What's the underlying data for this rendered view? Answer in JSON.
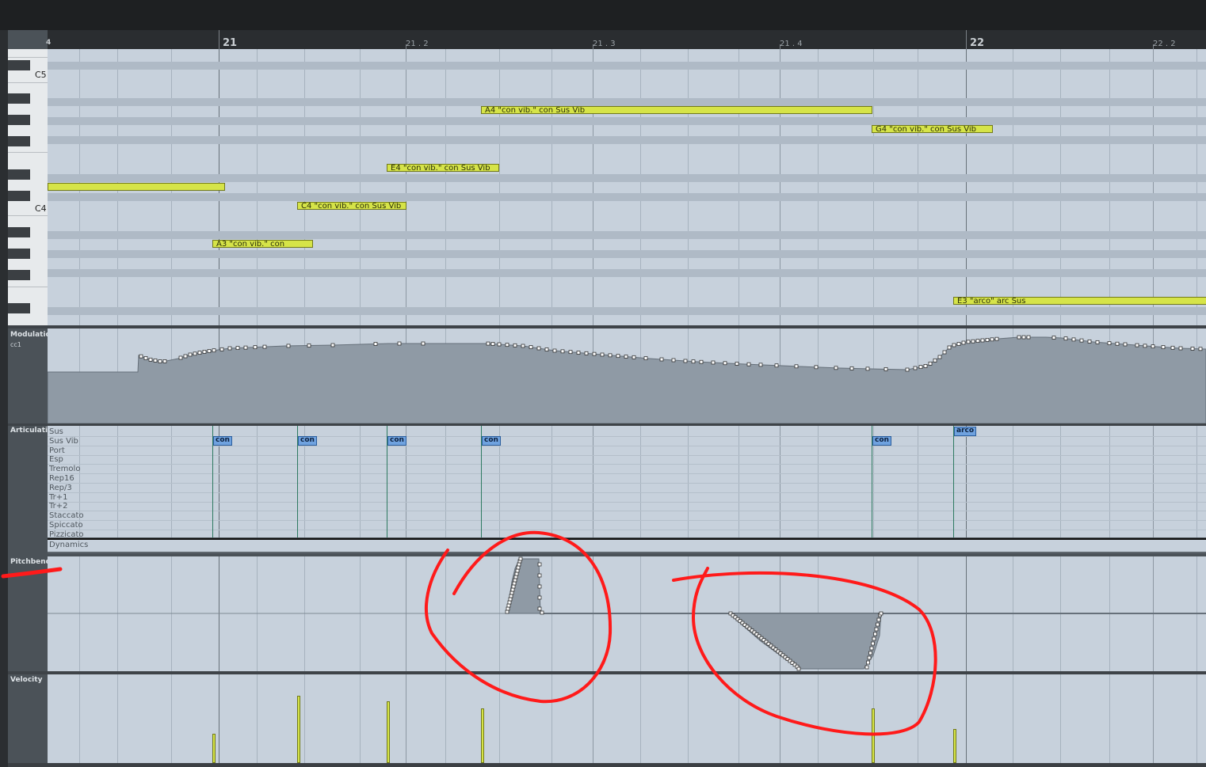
{
  "ruler": {
    "bars": [
      "21",
      "22"
    ],
    "beats": [
      "21 . 2",
      "21 . 3",
      "21 . 4",
      "22 . 2"
    ],
    "partial_left": "4"
  },
  "keyboard": {
    "c5_label": "C5",
    "c4_label": "C4"
  },
  "notes": [
    {
      "label": ""
    },
    {
      "label": "A3 \"con vib.\" con"
    },
    {
      "label": "C4 \"con vib.\" con Sus Vib"
    },
    {
      "label": "E4 \"con vib.\" con Sus Vib"
    },
    {
      "label": "A4 \"con vib.\" con Sus Vib"
    },
    {
      "label": "G4 \"con vib.\" con Sus Vib"
    },
    {
      "label": "E3 \"arco\" arc Sus"
    }
  ],
  "lanes": {
    "modulation": {
      "title": "Modulatio",
      "sub": "cc1"
    },
    "articulation": {
      "title": "Articulatio"
    },
    "pitchbend": {
      "title": "Pitchbend"
    },
    "velocity": {
      "title": "Velocity"
    },
    "dynamics": {
      "label": "Dynamics"
    }
  },
  "articulation_rows": [
    "Sus",
    "Sus Vib",
    "Port",
    "Esp",
    "Tremolo",
    "Rep16",
    "Rep/3",
    "Tr+1",
    "Tr+2",
    "Staccato",
    "Spiccato",
    "Pizzicato"
  ],
  "articulation_events": [
    {
      "tag": "con",
      "row": "Sus Vib"
    },
    {
      "tag": "con",
      "row": "Sus Vib"
    },
    {
      "tag": "con",
      "row": "Sus Vib"
    },
    {
      "tag": "con",
      "row": "Sus Vib"
    },
    {
      "tag": "con",
      "row": "Sus Vib"
    },
    {
      "tag": "arco",
      "row": "Sus"
    }
  ],
  "velocity_values": [
    0.33,
    0.76,
    0.7,
    0.62,
    0.62,
    0.38
  ],
  "colors": {
    "note": "#d6e448",
    "grid": "#c7d1dc",
    "annotation": "#ff1a1a",
    "articulation_tag": "#6fa2df"
  }
}
